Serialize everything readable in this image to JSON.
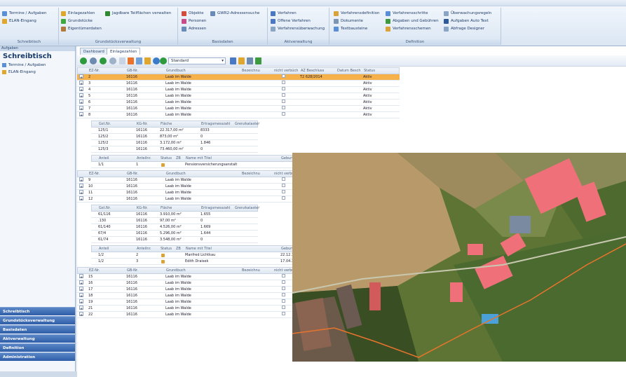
{
  "ribbon": {
    "groups": [
      {
        "caption": "Schreibtisch",
        "items": [
          "Termine / Aufgaben",
          "ELAN-Eingang"
        ]
      },
      {
        "caption": "Grundstücksverwaltung",
        "items": [
          "Einlagezahlen",
          "Grundstücke",
          "Eigentümerdaten",
          "Jagdbare Teilflächen verwalten"
        ]
      },
      {
        "caption": "Basisdaten",
        "items": [
          "Objekte",
          "GWR2-Adressensuche",
          "Personen",
          "Adressen"
        ]
      },
      {
        "caption": "Aktverwaltung",
        "items": [
          "Verfahren",
          "Offene Verfahren",
          "Verfahrensüberwachung"
        ]
      },
      {
        "caption": "Definition",
        "items": [
          "Verfahrensdefinition",
          "Verfahrensschritte",
          "Überwachungsregeln",
          "Dokumente",
          "Abgaben und Gebühren",
          "Aufgaben Auto Text",
          "Textbausteine",
          "Verfahrensschemen",
          "Abfrage Designer"
        ]
      }
    ]
  },
  "left": {
    "header": "Aufgaben",
    "title": "Schreibtisch",
    "items": [
      "Termine / Aufgaben",
      "ELAN-Eingang"
    ],
    "buttons": [
      "Schreibtisch",
      "Grundstücksverwaltung",
      "Basisdaten",
      "Aktverwaltung",
      "Definition",
      "Administration"
    ]
  },
  "tabs": [
    "Dashboard",
    "Einlagezahlen"
  ],
  "toolbar": {
    "view": "Standard"
  },
  "grid": {
    "headers": [
      "EZ-Nr.",
      "GB-Nr.",
      "Grundbuch",
      "Bezeichnu",
      "nicht verbüch",
      "AZ Beschluss",
      "Datum Besch",
      "Status"
    ],
    "rows1": [
      {
        "ez": "2",
        "gb": "16116",
        "name": "Laab im Walde",
        "az": "T2 628/2014",
        "status": "Aktiv"
      },
      {
        "ez": "3",
        "gb": "16116",
        "name": "Laab im Walde",
        "az": "",
        "status": "Aktiv"
      },
      {
        "ez": "4",
        "gb": "16116",
        "name": "Laab im Walde",
        "az": "",
        "status": "Aktiv"
      },
      {
        "ez": "5",
        "gb": "16116",
        "name": "Laab im Walde",
        "az": "",
        "status": "Aktiv"
      },
      {
        "ez": "6",
        "gb": "16116",
        "name": "Laab im Walde",
        "az": "",
        "status": "Aktiv"
      },
      {
        "ez": "7",
        "gb": "16116",
        "name": "Laab im Walde",
        "az": "",
        "status": "Aktiv"
      },
      {
        "ez": "8",
        "gb": "16116",
        "name": "Laab im Walde",
        "az": "",
        "status": "Aktiv"
      }
    ],
    "subHeaders": [
      "Gst.Nr.",
      "KG-Nr.",
      "Fläche",
      "Ertragsmesszahl",
      "Grenzkataster"
    ],
    "sub1": [
      {
        "gst": "125/1",
        "kg": "16116",
        "flaeche": "22.317,00 m²",
        "ert": "8333"
      },
      {
        "gst": "125/2",
        "kg": "16116",
        "flaeche": "873,00 m²",
        "ert": "0"
      },
      {
        "gst": "125/2",
        "kg": "16116",
        "flaeche": "3.172,00 m²",
        "ert": "1.846"
      },
      {
        "gst": "125/3",
        "kg": "16116",
        "flaeche": "73.460,00 m²",
        "ert": "0"
      }
    ],
    "ownerHeaders": [
      "Anteil",
      "Anteilnr.",
      "Status",
      "ZB",
      "Name mit Titel",
      "Geburt"
    ],
    "owner1": [
      {
        "anteil": "1/1",
        "nr": "1",
        "name": "Pensionsversicherungsanstalt"
      }
    ],
    "rows2": [
      {
        "ez": "9",
        "gb": "16116",
        "name": "Laab im Walde"
      },
      {
        "ez": "10",
        "gb": "16116",
        "name": "Laab im Walde"
      },
      {
        "ez": "11",
        "gb": "16116",
        "name": "Laab im Walde"
      },
      {
        "ez": "12",
        "gb": "16116",
        "name": "Laab im Walde"
      }
    ],
    "sub2": [
      {
        "gst": "61/116",
        "kg": "16116",
        "flaeche": "3.910,00 m²",
        "ert": "1.655"
      },
      {
        "gst": ".130",
        "kg": "16116",
        "flaeche": "97,00 m²",
        "ert": "0"
      },
      {
        "gst": "61/140",
        "kg": "16116",
        "flaeche": "4.526,00 m²",
        "ert": "1.669"
      },
      {
        "gst": "67/4",
        "kg": "16116",
        "flaeche": "5.296,00 m²",
        "ert": "1.644"
      },
      {
        "gst": "61/74",
        "kg": "16116",
        "flaeche": "3.548,00 m²",
        "ert": "0"
      }
    ],
    "owner2": [
      {
        "anteil": "1/2",
        "nr": "2",
        "name": "Manfred Lichtkau",
        "geb": "22.12.1"
      },
      {
        "anteil": "1/2",
        "nr": "3",
        "name": "Edith Draisek",
        "geb": "17.04.1"
      }
    ],
    "rows3": [
      {
        "ez": "15",
        "gb": "16116",
        "name": "Laab im Walde"
      },
      {
        "ez": "16",
        "gb": "16116",
        "name": "Laab im Walde"
      },
      {
        "ez": "17",
        "gb": "16116",
        "name": "Laab im Walde"
      },
      {
        "ez": "18",
        "gb": "16116",
        "name": "Laab im Walde"
      },
      {
        "ez": "19",
        "gb": "16116",
        "name": "Laab im Walde"
      },
      {
        "ez": "21",
        "gb": "16116",
        "name": "Laab im Walde",
        "status": "Aktiv"
      },
      {
        "ez": "22",
        "gb": "16116",
        "name": "Laab im Walde",
        "status": "Aktiv"
      }
    ]
  },
  "colors": {
    "selectedRow": "#f7b14a",
    "roof": "#e8636f",
    "field": "#b89a6a"
  }
}
